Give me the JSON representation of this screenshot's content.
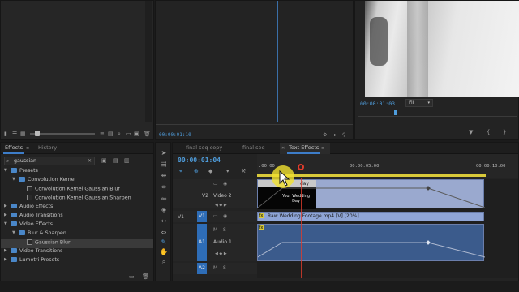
{
  "colors": {
    "accent": "#4f9ddc",
    "tab_underline": "#3d7dc9",
    "video_clip": "#8fa5d6",
    "audio_clip": "#3b5b8c",
    "cursor_highlight": "#f2e230",
    "playhead_marker": "#e03c2c"
  },
  "source_monitor": {
    "timecode": "00:00:01:10"
  },
  "program_monitor": {
    "timecode": "00:00:01:03",
    "zoom": "Fit"
  },
  "effects_panel": {
    "tabs": [
      "Effects",
      "History"
    ],
    "search": {
      "value": "gaussian"
    },
    "tree": [
      {
        "label": "Presets",
        "type": "folder",
        "depth": 0,
        "expanded": true
      },
      {
        "label": "Convolution Kernel",
        "type": "folder",
        "depth": 1,
        "expanded": true
      },
      {
        "label": "Convolution Kernel Gaussian Blur",
        "type": "effect",
        "depth": 2
      },
      {
        "label": "Convolution Kernel Gaussian Sharpen",
        "type": "effect",
        "depth": 2
      },
      {
        "label": "Audio Effects",
        "type": "folder",
        "depth": 0,
        "expanded": false
      },
      {
        "label": "Audio Transitions",
        "type": "folder",
        "depth": 0,
        "expanded": false
      },
      {
        "label": "Video Effects",
        "type": "folder",
        "depth": 0,
        "expanded": true
      },
      {
        "label": "Blur & Sharpen",
        "type": "folder",
        "depth": 1,
        "expanded": true
      },
      {
        "label": "Gaussian Blur",
        "type": "effect",
        "depth": 2,
        "selected": true
      },
      {
        "label": "Video Transitions",
        "type": "folder",
        "depth": 0,
        "expanded": false
      },
      {
        "label": "Lumetri Presets",
        "type": "folder",
        "depth": 0,
        "expanded": false
      }
    ]
  },
  "timeline": {
    "tabs": [
      "final seq copy",
      "final seq",
      "Text Effects"
    ],
    "active_tab": "Text Effects",
    "timecode": "00:00:01:04",
    "ruler": {
      "start": ":00:00",
      "mid": "00:00:05:00",
      "end": "00:00:10:00"
    },
    "tracks": [
      {
        "name": "V2",
        "label": "Video 2"
      },
      {
        "name": "V1",
        "label": "",
        "source": "V1"
      },
      {
        "name": "A1",
        "label": "Audio 1"
      },
      {
        "name": "A2",
        "label": ""
      }
    ],
    "clips": {
      "title_clip_label": "day",
      "title_thumbnail_text": "Your Wedding Day",
      "video_clip_label": "Raw Wedding Footage.mp4 [V] [20%]"
    }
  }
}
